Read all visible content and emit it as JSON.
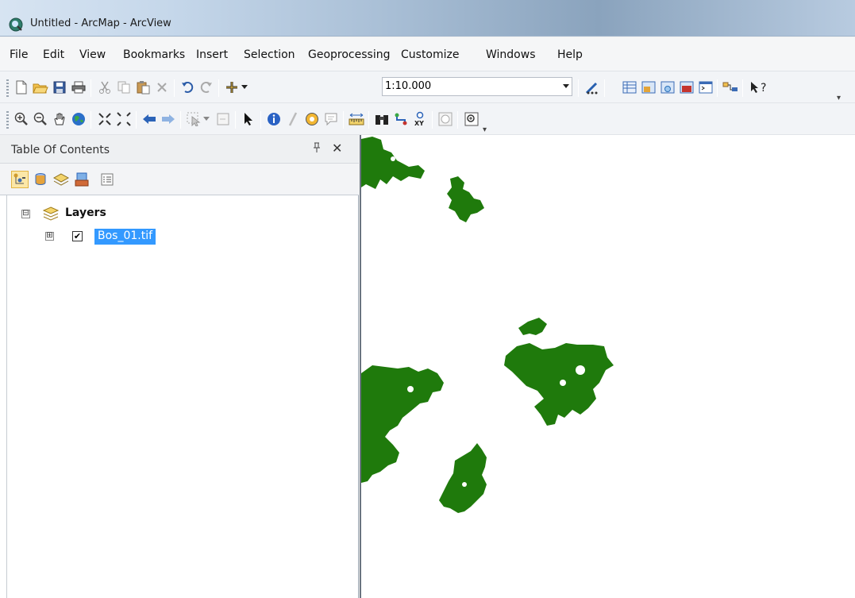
{
  "window": {
    "title": "Untitled - ArcMap - ArcView"
  },
  "menu": [
    "File",
    "Edit",
    "View",
    "Bookmarks",
    "Insert",
    "Selection",
    "Geoprocessing",
    "Customize",
    "Windows",
    "Help"
  ],
  "toolbar": {
    "scale": "1:10.000"
  },
  "toc": {
    "title": "Table Of Contents",
    "root_label": "Layers",
    "root_expander": "⊟",
    "layer": {
      "label": "Bos_01.tif",
      "checked": "✔",
      "expander": "⊞"
    }
  },
  "icons": {
    "pin": "ᵖ",
    "close": "✕",
    "overflow": "▾"
  },
  "colors": {
    "forest": "#1f7a0c",
    "selection": "#3399ff"
  }
}
